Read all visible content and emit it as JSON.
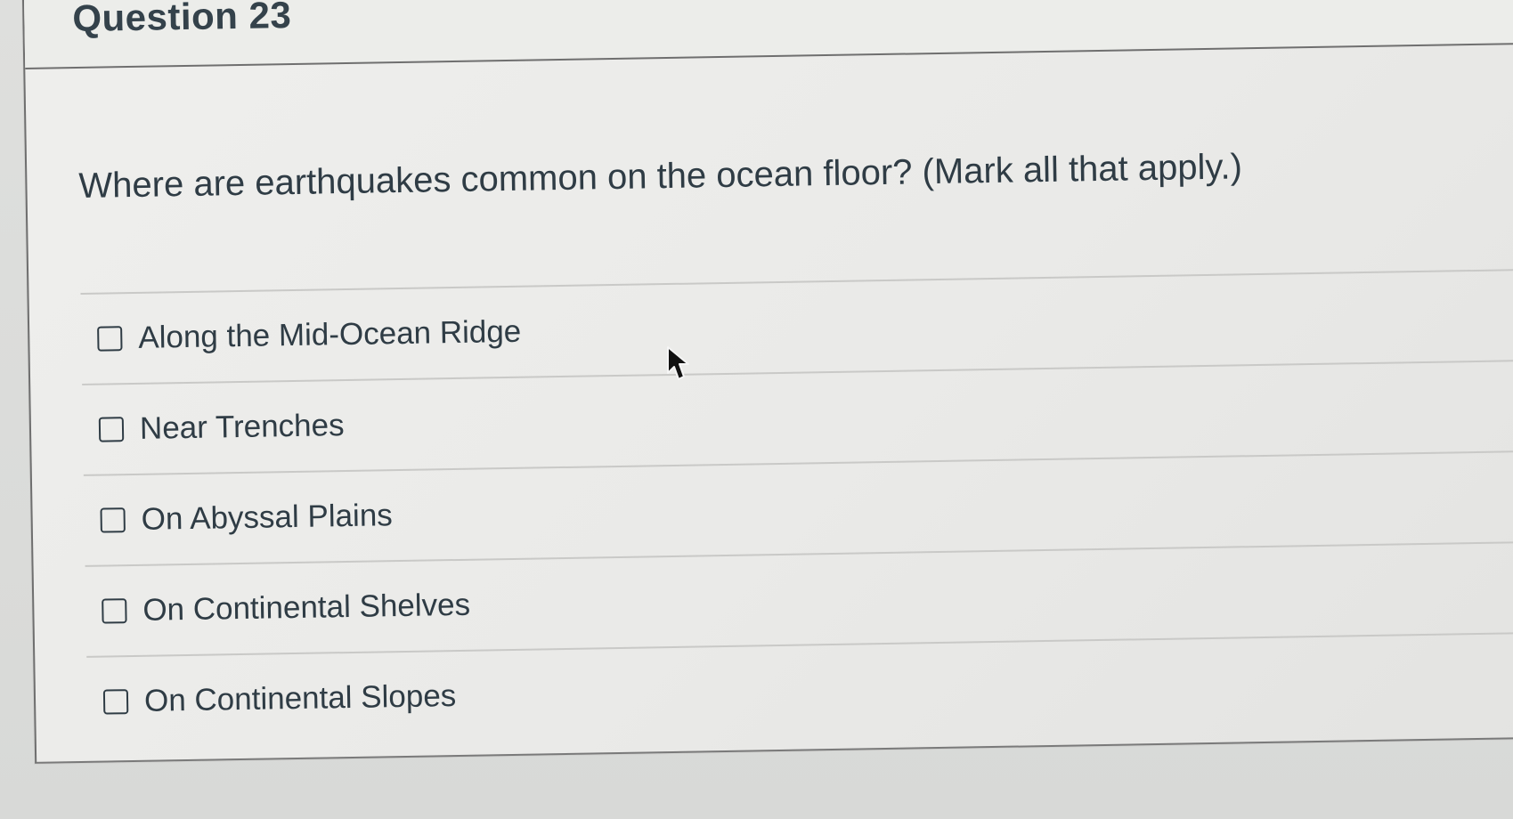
{
  "question": {
    "title": "Question 23",
    "prompt": "Where are earthquakes common on the ocean floor? (Mark all that apply.)",
    "answers": [
      {
        "label": "Along the Mid-Ocean Ridge"
      },
      {
        "label": "Near Trenches"
      },
      {
        "label": "On Abyssal Plains"
      },
      {
        "label": "On Continental Shelves"
      },
      {
        "label": "On Continental Slopes"
      }
    ]
  },
  "cursor": {
    "icon": "arrow-pointer-icon"
  }
}
